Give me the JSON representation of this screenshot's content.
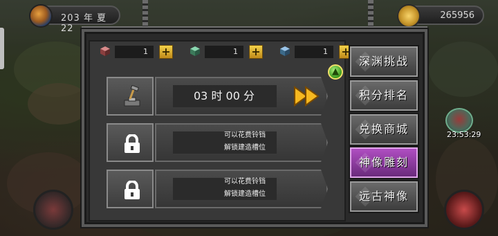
{
  "hud": {
    "date": "203 年 夏 22",
    "gold": "265956"
  },
  "resources": [
    {
      "icon": "red-cube-icon",
      "count": "1",
      "plus": "+"
    },
    {
      "icon": "green-cube-icon",
      "count": "1",
      "plus": "+"
    },
    {
      "icon": "blue-cube-icon",
      "count": "1",
      "plus": "+"
    }
  ],
  "slots": [
    {
      "time": "03 时 00 分"
    },
    {
      "hint_line1": "可以花费铃铛",
      "hint_line2": "解锁建造槽位"
    },
    {
      "hint_line1": "可以花费铃铛",
      "hint_line2": "解锁建造槽位"
    }
  ],
  "menu": {
    "items": [
      {
        "label": "深渊挑战"
      },
      {
        "label": "积分排名"
      },
      {
        "label": "兑换商城"
      },
      {
        "label": "神像雕刻"
      },
      {
        "label": "远古神像"
      }
    ],
    "active_index": 3
  },
  "right_hud": {
    "timer": "23:53:29"
  },
  "colors": {
    "accent_gold": "#f3d24a",
    "active_purple": "#b04ec2",
    "upgrade_green": "#3c9a1c"
  }
}
